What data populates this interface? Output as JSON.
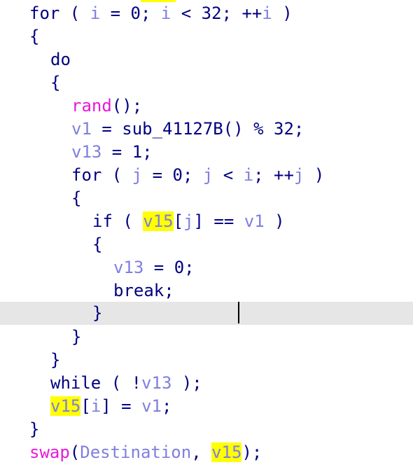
{
  "highlight_var": "v15",
  "colors": {
    "keyword": "#000080",
    "variable": "#7f7fdf",
    "function": "#e61ad8",
    "highlight": "#ffff00",
    "current_line": "#e6e6e6"
  },
  "code": {
    "l1_for": "for",
    "l1_open": " ( ",
    "l1_i1": "i",
    "l1_eq": " = 0; ",
    "l1_i2": "i",
    "l1_lt": " < 32; ++",
    "l1_i3": "i",
    "l1_close": " )",
    "l2": "{",
    "l3_do": "do",
    "l4": "{",
    "l5_rand": "rand",
    "l5_rest": "();",
    "l6_v1": "v1",
    "l6_rest": " = sub_41127B() % 32;",
    "l7_v13": "v13",
    "l7_rest": " = 1;",
    "l8_for": "for",
    "l8_open": " ( ",
    "l8_j1": "j",
    "l8_eq": " = 0; ",
    "l8_j2": "j",
    "l8_lt": " < ",
    "l8_i": "i",
    "l8_inc": "; ++",
    "l8_j3": "j",
    "l8_close": " )",
    "l9": "{",
    "l10_if": "if",
    "l10_open": " ( ",
    "l10_v15": "v15",
    "l10_b1": "[",
    "l10_j": "j",
    "l10_b2": "] == ",
    "l10_v1": "v1",
    "l10_close": " )",
    "l11": "{",
    "l12_v13": "v13",
    "l12_rest": " = 0;",
    "l13_break": "break",
    "l13_semi": ";",
    "l14": "}",
    "l15": "}",
    "l16": "}",
    "l17_while": "while",
    "l17_open": " ( !",
    "l17_v13": "v13",
    "l17_close": " );",
    "l18_v15": "v15",
    "l18_b1": "[",
    "l18_i": "i",
    "l18_b2": "] = ",
    "l18_v1": "v1",
    "l18_semi": ";",
    "l19": "}",
    "l20_swap": "swap",
    "l20_open": "(",
    "l20_dest": "Destination",
    "l20_comma": ", ",
    "l20_v15": "v15",
    "l20_close": ");"
  }
}
